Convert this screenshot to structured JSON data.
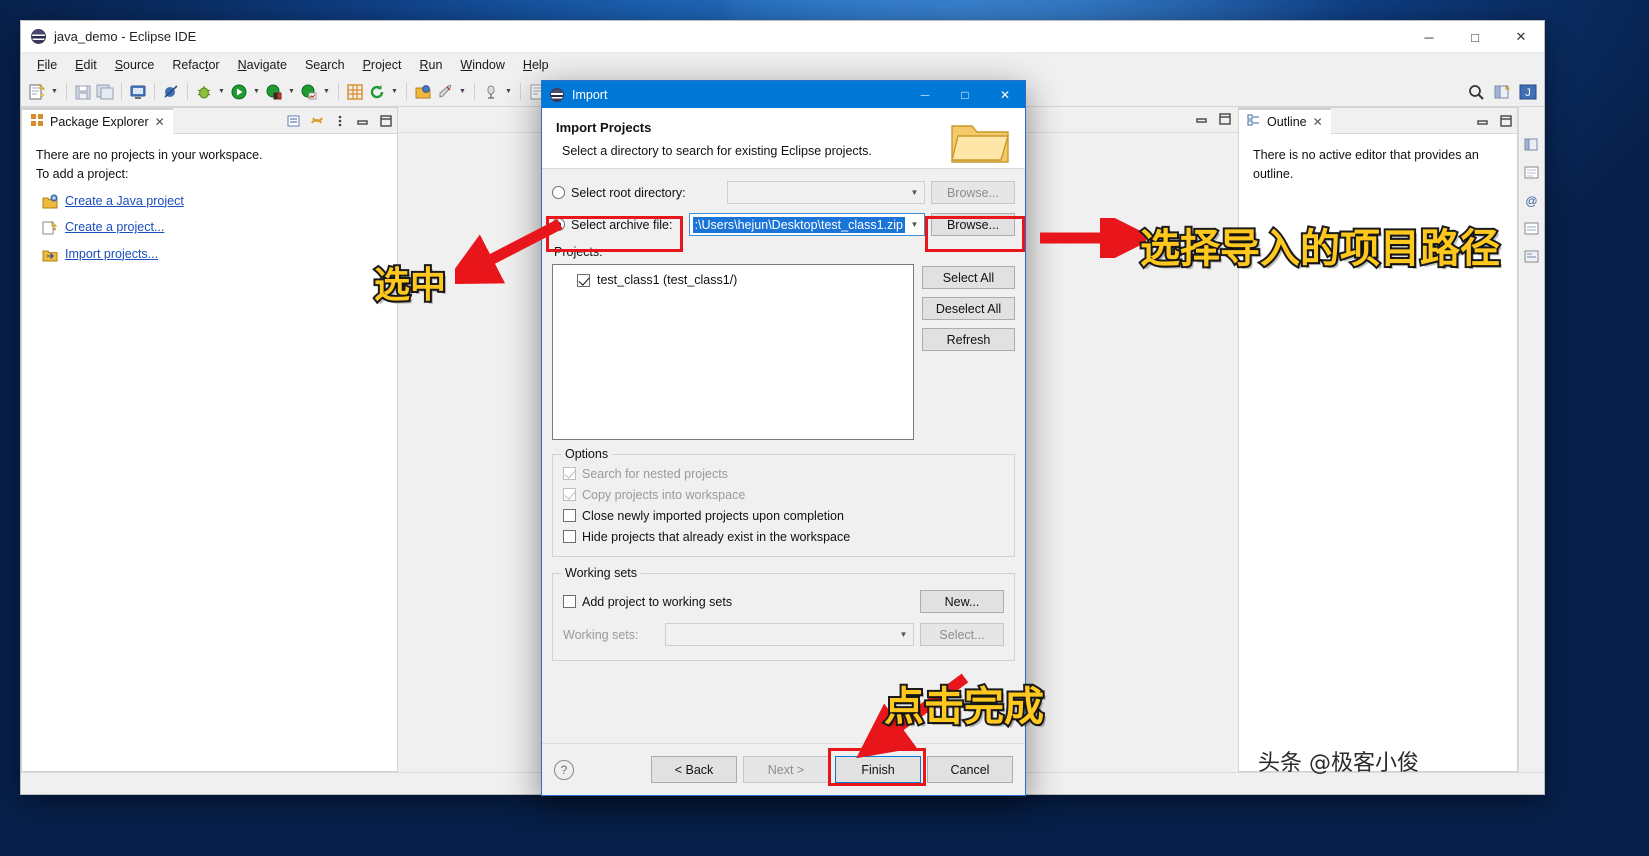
{
  "window": {
    "title": "java_demo - Eclipse IDE",
    "logo_icon": "eclipse-logo-icon",
    "minimize": "─",
    "maximize": "□",
    "close": "✕"
  },
  "menubar": {
    "items": [
      {
        "label": "File",
        "mnemonic": "F"
      },
      {
        "label": "Edit",
        "mnemonic": "E"
      },
      {
        "label": "Source",
        "mnemonic": "S"
      },
      {
        "label": "Refactor",
        "mnemonic": "t"
      },
      {
        "label": "Navigate",
        "mnemonic": "N"
      },
      {
        "label": "Search",
        "mnemonic": "a"
      },
      {
        "label": "Project",
        "mnemonic": "P"
      },
      {
        "label": "Run",
        "mnemonic": "R"
      },
      {
        "label": "Window",
        "mnemonic": "W"
      },
      {
        "label": "Help",
        "mnemonic": "H"
      }
    ]
  },
  "toolbar": {
    "icons": [
      "new-wizard-icon",
      "save-icon",
      "save-all-icon",
      "console-icon",
      "skip-breakpoints-icon",
      "debug-icon",
      "run-icon",
      "coverage-icon",
      "profile-icon",
      "new-java-package-icon",
      "refresh-icon",
      "open-type-icon",
      "launch-icon",
      "external-tools-icon"
    ],
    "right_icons": [
      "search-icon",
      "open-perspective-icon",
      "java-perspective-icon"
    ]
  },
  "package_explorer": {
    "tab_label": "Package Explorer",
    "tab_icon": "package-explorer-icon",
    "close_icon": "✕",
    "toolbar_icons": [
      "collapse-all-icon",
      "link-with-editor-icon",
      "view-menu-icon",
      "minimize-icon",
      "maximize-icon"
    ],
    "empty_line1": "There are no projects in your workspace.",
    "empty_line2": "To add a project:",
    "links": [
      {
        "label": "Create a Java project",
        "icon": "new-java-project-icon"
      },
      {
        "label": "Create a project...",
        "icon": "new-project-icon"
      },
      {
        "label": "Import projects...",
        "icon": "import-projects-icon"
      }
    ]
  },
  "outline": {
    "tab_label": "Outline",
    "tab_icon": "outline-icon",
    "close_icon": "✕",
    "empty_text": "There is no active editor that provides an outline.",
    "minimize_icon": "─",
    "maximize_icon": "□"
  },
  "editor_area": {
    "minimize_icon": "─",
    "maximize_icon": "□"
  },
  "dialog": {
    "title": "Import",
    "title_icon": "eclipse-logo-icon",
    "minimize": "─",
    "maximize": "□",
    "close": "✕",
    "heading": "Import Projects",
    "subheading": "Select a directory to search for existing Eclipse projects.",
    "header_icon": "import-folder-icon",
    "source": {
      "root_directory": {
        "label": "Select root directory:",
        "selected": false,
        "value": "",
        "placeholder": "",
        "browse_label": "Browse...",
        "browse_enabled": false
      },
      "archive_file": {
        "label": "Select archive file:",
        "selected": true,
        "value": ":\\Users\\hejun\\Desktop\\test_class1.zip",
        "browse_label": "Browse...",
        "browse_enabled": true
      }
    },
    "projects": {
      "label": "Projects:",
      "items": [
        {
          "label": "test_class1 (test_class1/)",
          "checked": true
        }
      ],
      "buttons": [
        {
          "label": "Select All",
          "enabled": true
        },
        {
          "label": "Deselect All",
          "enabled": true
        },
        {
          "label": "Refresh",
          "enabled": true
        }
      ]
    },
    "options": {
      "title": "Options",
      "items": [
        {
          "label": "Search for nested projects",
          "checked": true,
          "enabled": false
        },
        {
          "label": "Copy projects into workspace",
          "checked": true,
          "enabled": false
        },
        {
          "label": "Close newly imported projects upon completion",
          "checked": false,
          "enabled": true
        },
        {
          "label": "Hide projects that already exist in the workspace",
          "checked": false,
          "enabled": true
        }
      ]
    },
    "working_sets": {
      "title": "Working sets",
      "add_label": "Add project to working sets",
      "add_checked": false,
      "new_label": "New...",
      "ws_label": "Working sets:",
      "ws_value": "",
      "select_label": "Select...",
      "enabled": false
    },
    "footer": {
      "help_icon": "?",
      "back_label": "< Back",
      "back_enabled": true,
      "next_label": "Next >",
      "next_enabled": false,
      "finish_label": "Finish",
      "finish_default": true,
      "cancel_label": "Cancel"
    }
  },
  "annotations": {
    "select_note": "选中",
    "path_note": "选择导入的项目路径",
    "finish_note": "点击完成",
    "watermark": "头条 @极客小俊",
    "highlight_color": "#e8161b",
    "text_color": "#ffc81e",
    "text_stroke": "#1b1b1b"
  }
}
